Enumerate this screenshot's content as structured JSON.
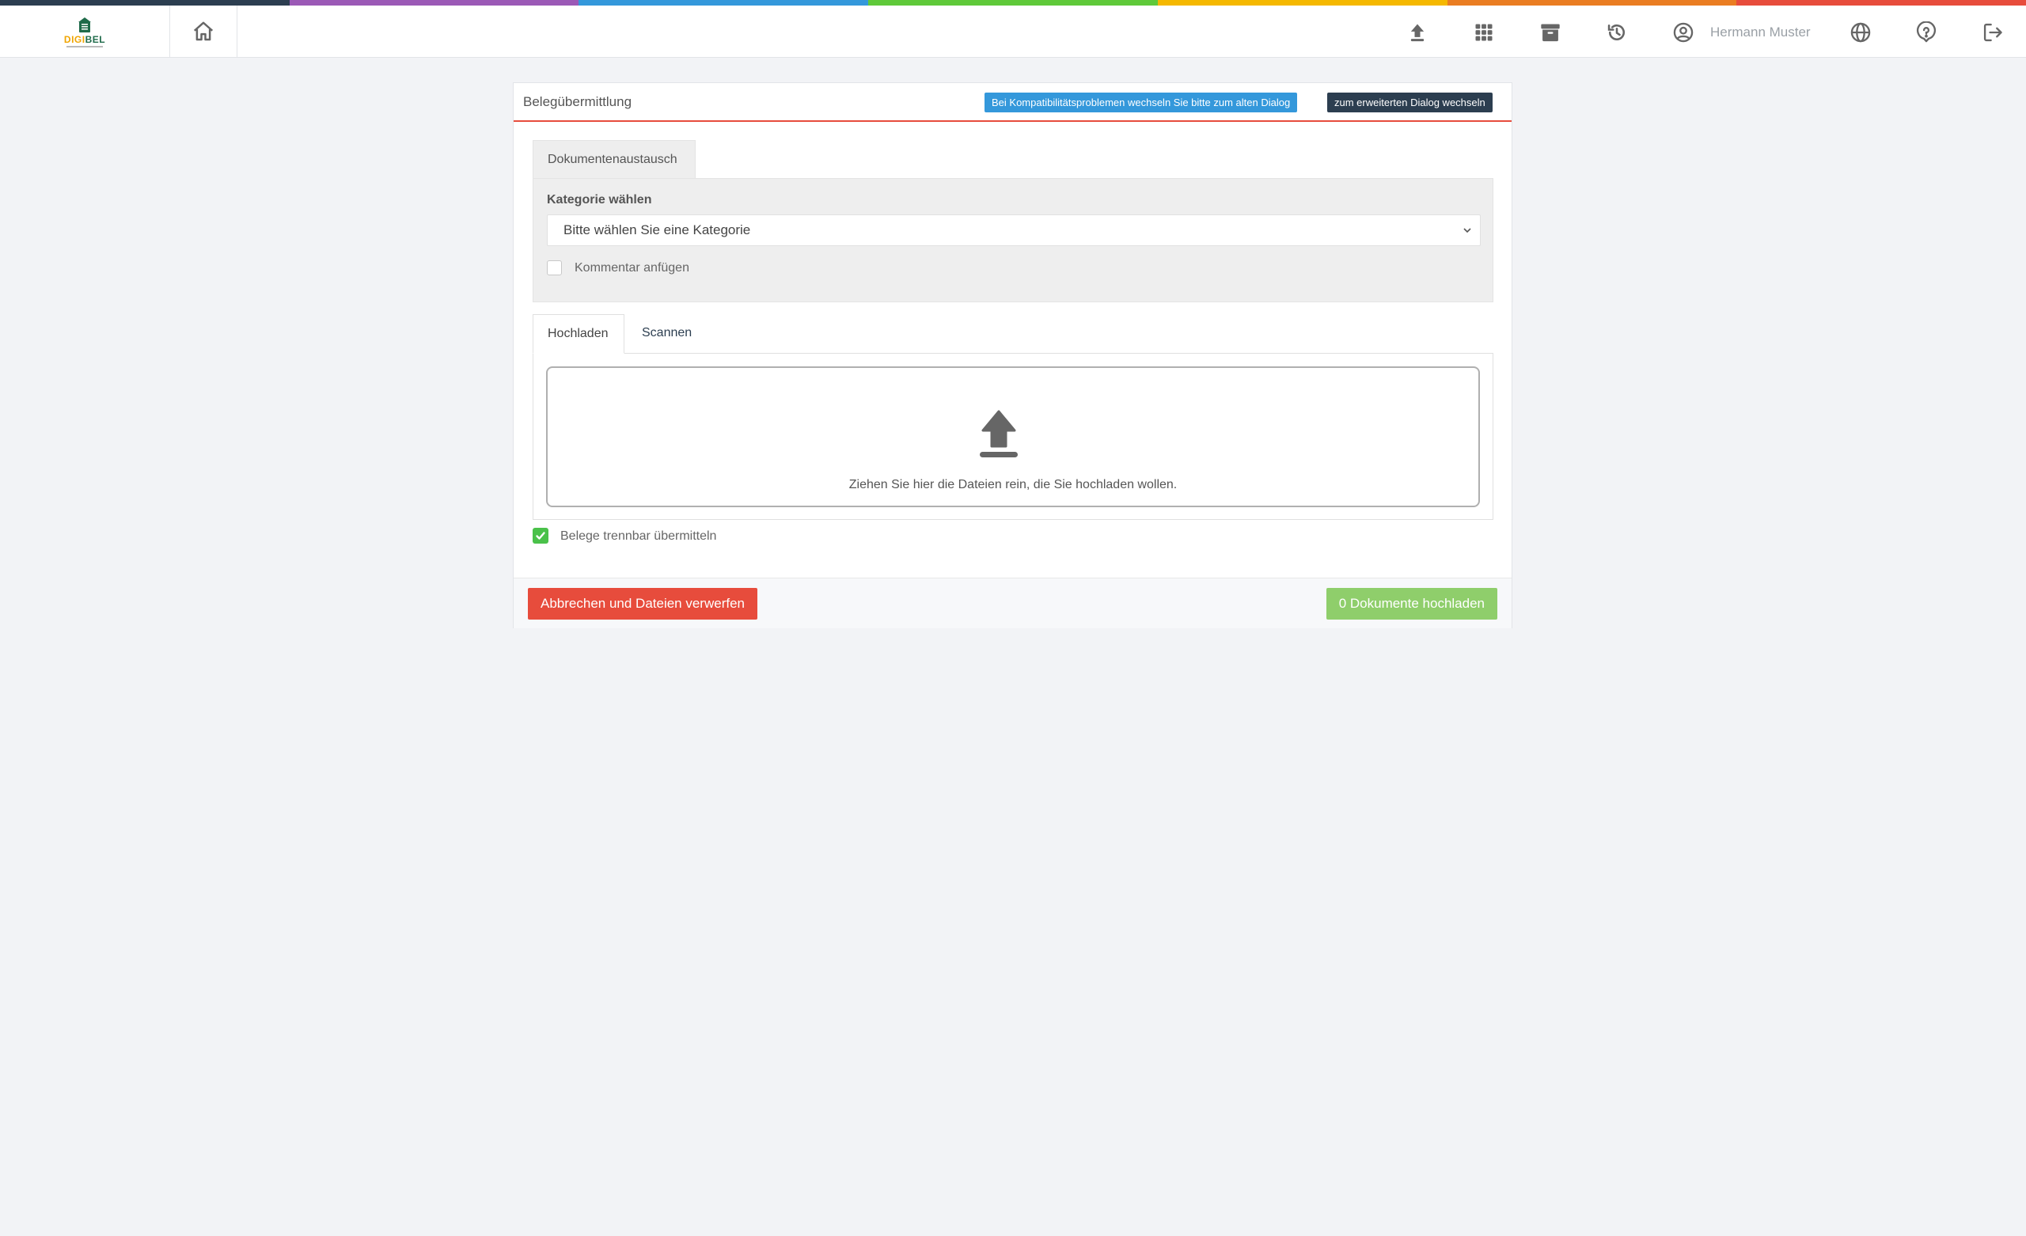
{
  "colors": {
    "strip": [
      "#2c3e50",
      "#9b59b6",
      "#3498db",
      "#5fc93a",
      "#f5b800",
      "#ea7d22",
      "#e74c3c"
    ],
    "accent_blue": "#3498db",
    "dark": "#2c3e50",
    "danger": "#e74c3c",
    "success": "#8fce6b",
    "check": "#4ac14a"
  },
  "header": {
    "logo": {
      "prefix": "DIGI",
      "suffix": "BEL",
      "icon": "house-logo-icon"
    },
    "icons": [
      "home-icon",
      "upload-icon",
      "apps-grid-icon",
      "archive-icon",
      "history-icon",
      "user-circle-icon",
      "globe-icon",
      "help-icon",
      "logout-icon"
    ],
    "user_name": "Hermann Muster"
  },
  "card": {
    "title": "Belegübermittlung",
    "compat_button": "Bei Kompatibilitätsproblemen wechseln Sie bitte zum alten Dialog",
    "extended_button": "zum erweiterten Dialog wechseln"
  },
  "document_exchange": {
    "tab_label": "Dokumentenaustausch",
    "category_label": "Kategorie wählen",
    "category_selected": "Bitte wählen Sie eine Kategorie",
    "comment_label": "Kommentar anfügen",
    "comment_checked": false
  },
  "upload_tabs": {
    "upload": "Hochladen",
    "scan": "Scannen",
    "active": "Hochladen"
  },
  "dropzone": {
    "text": "Ziehen Sie hier die Dateien rein, die Sie hochladen wollen.",
    "icon": "upload-icon"
  },
  "separable": {
    "label": "Belege trennbar übermitteln",
    "checked": true
  },
  "footer": {
    "cancel_button": "Abbrechen und Dateien verwerfen",
    "upload_button": "0 Dokumente hochladen"
  }
}
